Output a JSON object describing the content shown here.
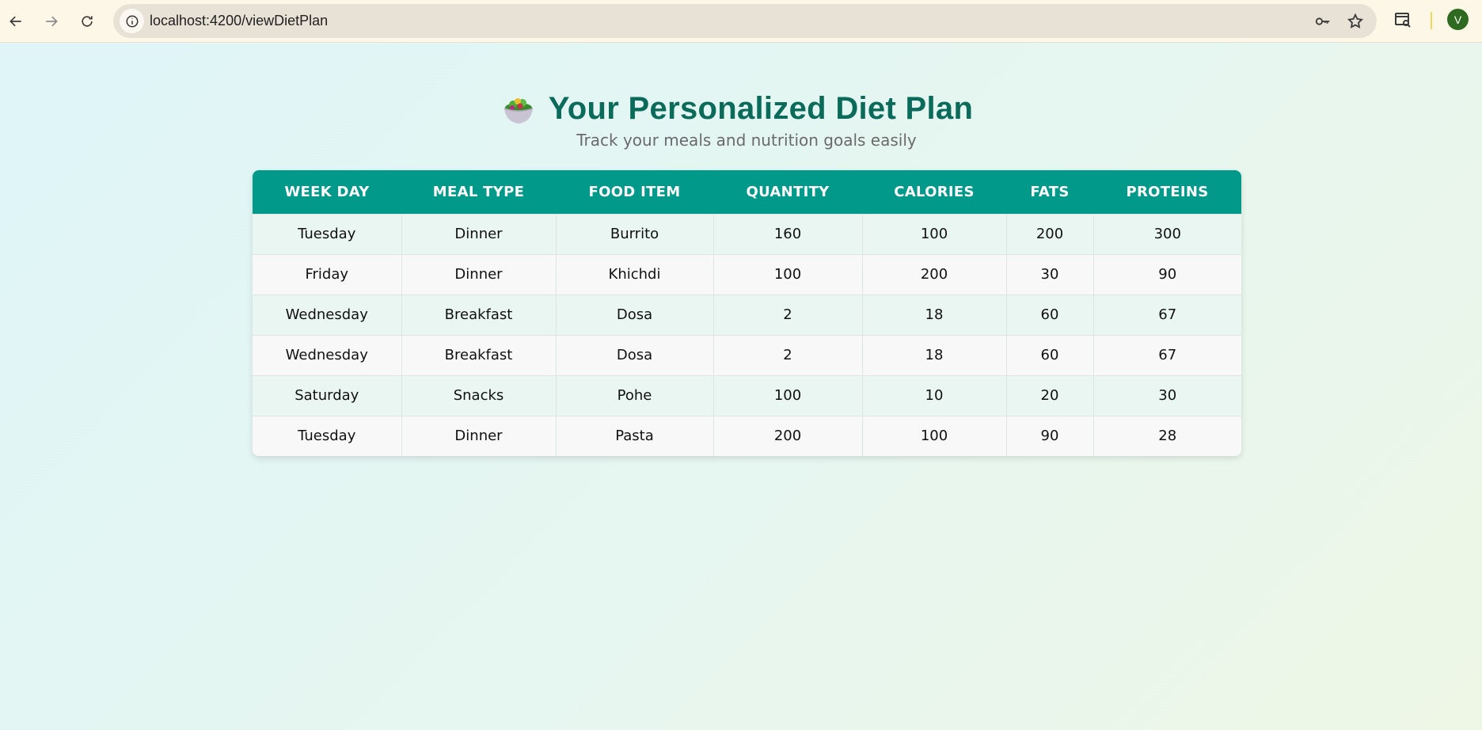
{
  "browser": {
    "url": "localhost:4200/viewDietPlan",
    "profile_initial": "V"
  },
  "header": {
    "title": "Your Personalized Diet Plan",
    "subtitle": "Track your meals and nutrition goals easily",
    "emoji_icon": "salad-bowl-icon"
  },
  "table": {
    "columns": [
      "WEEK DAY",
      "MEAL TYPE",
      "FOOD ITEM",
      "QUANTITY",
      "CALORIES",
      "FATS",
      "PROTEINS"
    ],
    "rows": [
      [
        "Tuesday",
        "Dinner",
        "Burrito",
        "160",
        "100",
        "200",
        "300"
      ],
      [
        "Friday",
        "Dinner",
        "Khichdi",
        "100",
        "200",
        "30",
        "90"
      ],
      [
        "Wednesday",
        "Breakfast",
        "Dosa",
        "2",
        "18",
        "60",
        "67"
      ],
      [
        "Wednesday",
        "Breakfast",
        "Dosa",
        "2",
        "18",
        "60",
        "67"
      ],
      [
        "Saturday",
        "Snacks",
        "Pohe",
        "100",
        "10",
        "20",
        "30"
      ],
      [
        "Tuesday",
        "Dinner",
        "Pasta",
        "200",
        "100",
        "90",
        "28"
      ]
    ]
  },
  "colors": {
    "header_bg": "#00998a",
    "title": "#0b6b5b",
    "row_alt": "#e9f6f1"
  }
}
